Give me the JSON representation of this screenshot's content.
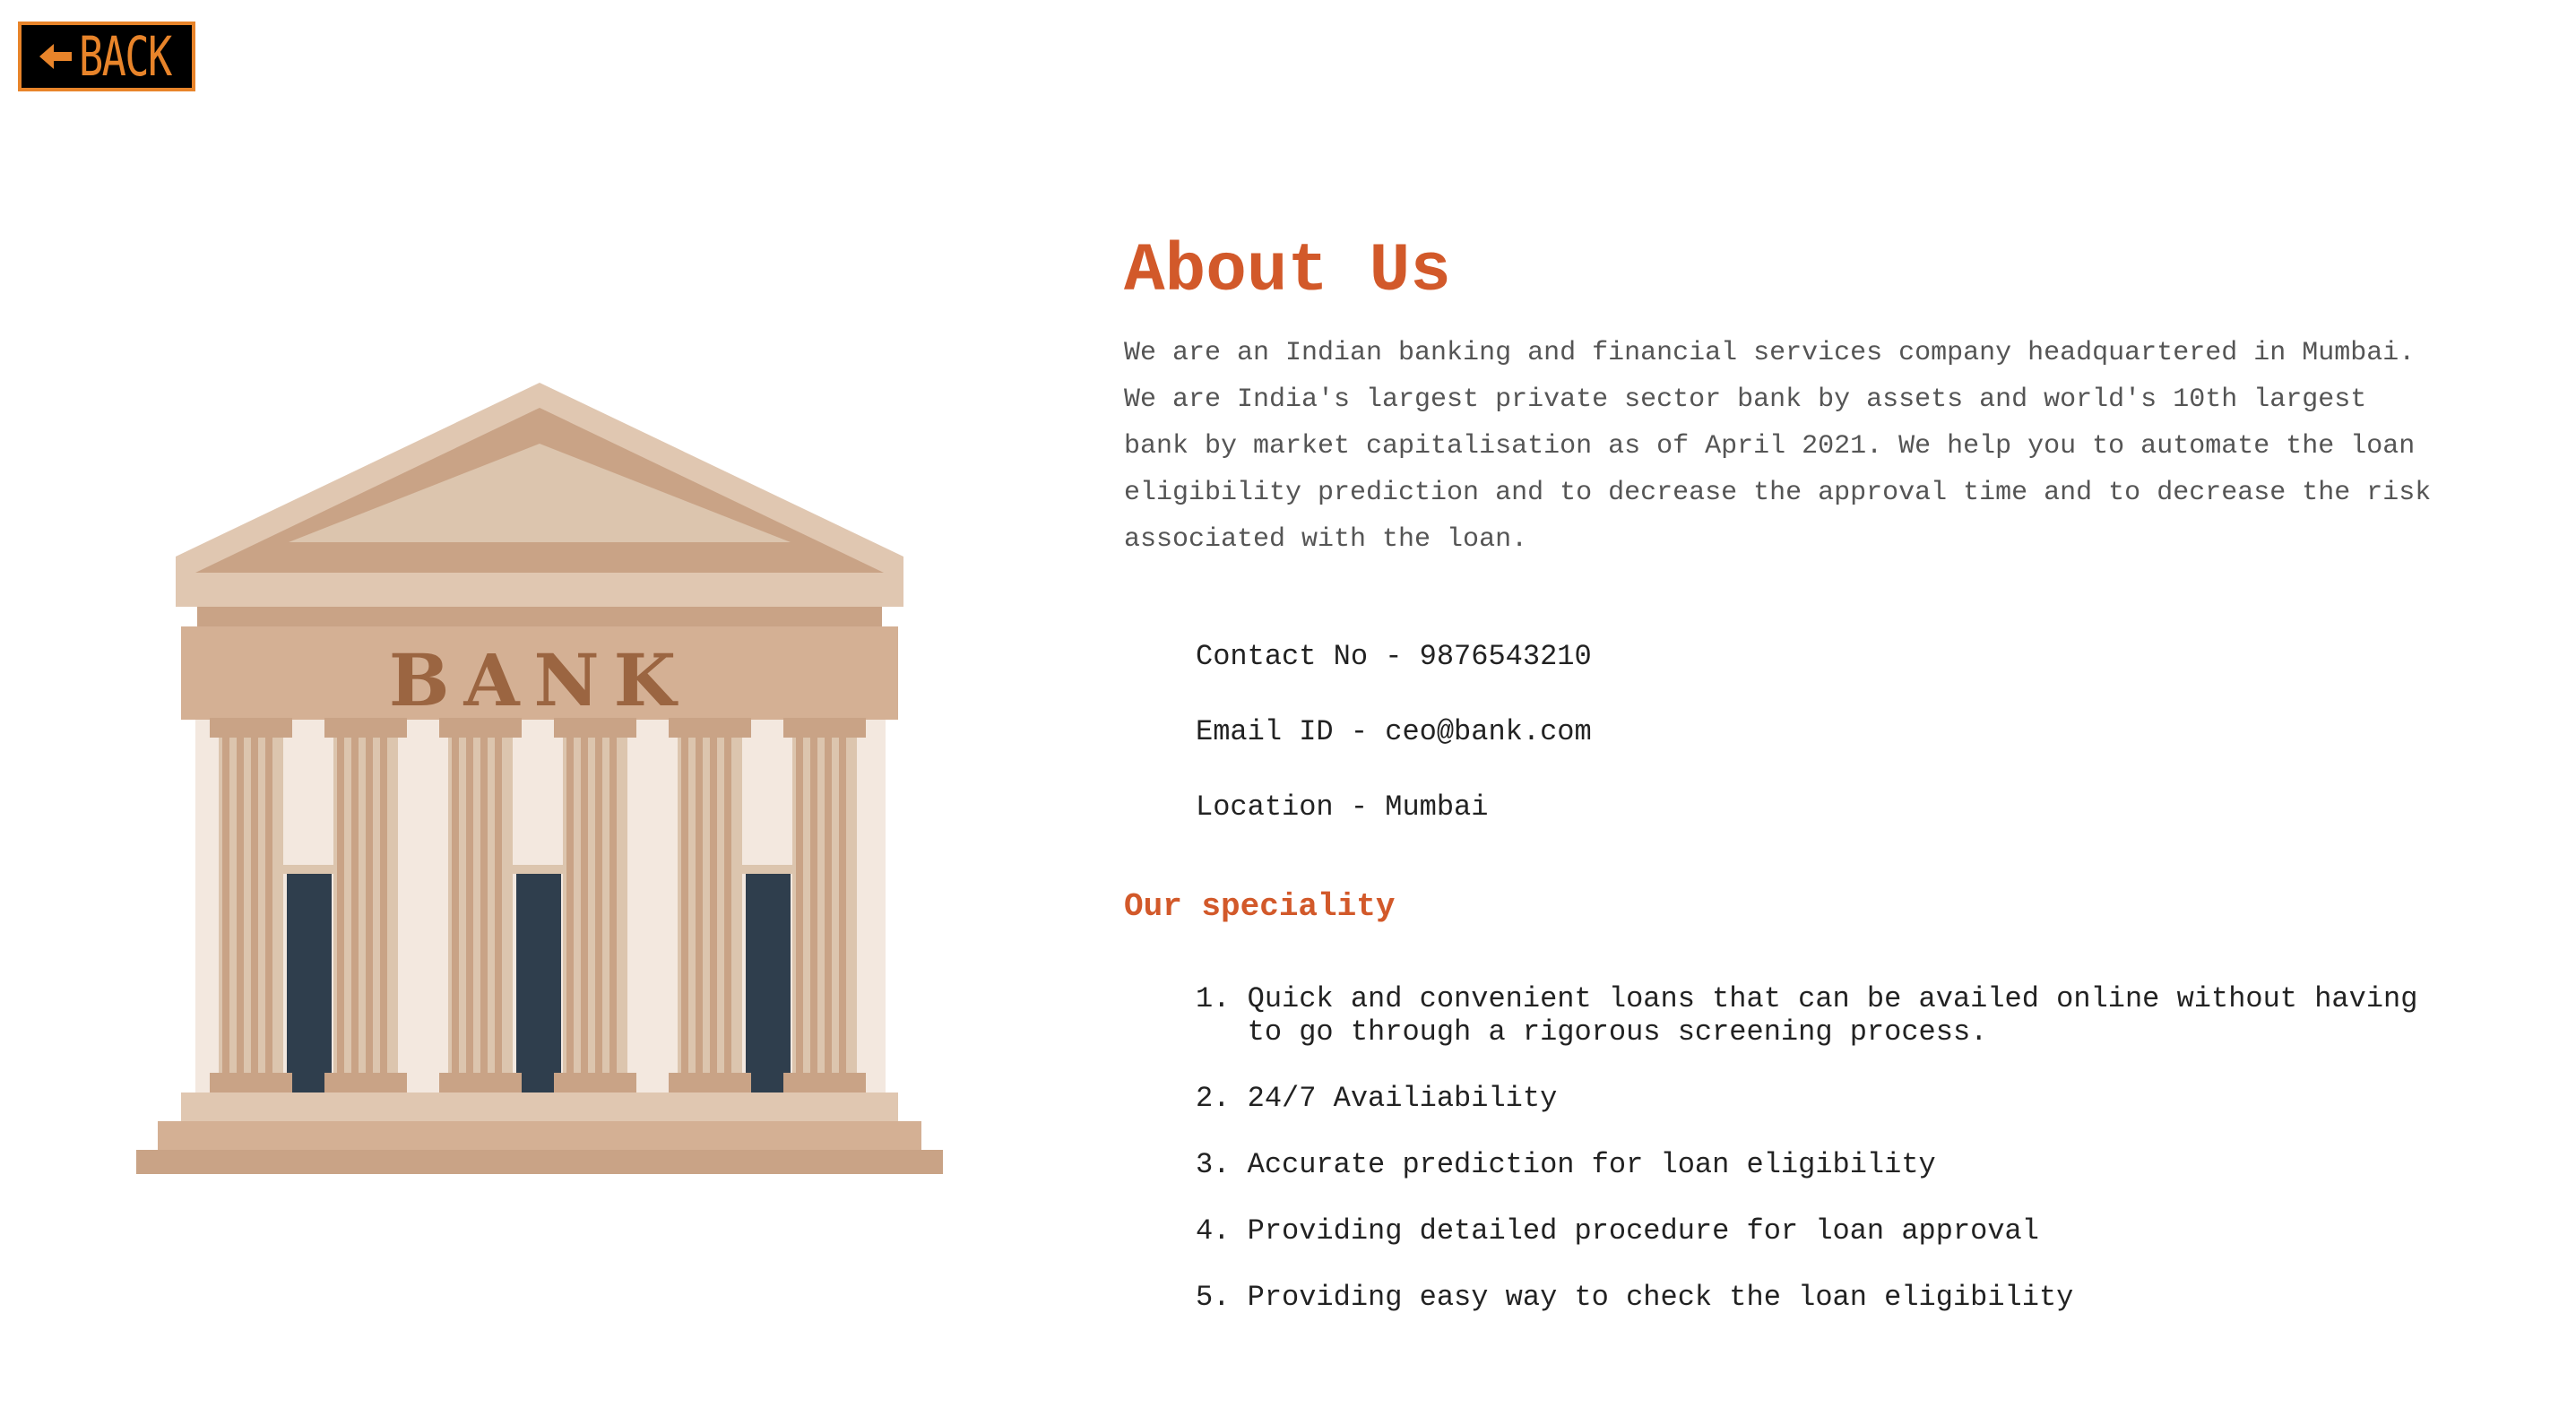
{
  "back_button": {
    "label": "BACK",
    "icon": "left-arrow-icon",
    "accent_color": "#e8842a"
  },
  "illustration": {
    "sign_text": "BANK",
    "icon": "bank-building-icon"
  },
  "about": {
    "title": "About Us",
    "description": "We are an Indian banking and financial services company headquartered in Mumbai. We are India's largest private sector bank by assets and world's 10th largest bank by market capitalisation as of April 2021. We help you to automate the loan eligibility prediction and to decrease the approval time and to decrease the risk associated with the loan.",
    "title_color": "#d2592a"
  },
  "contacts": [
    {
      "text": "Contact No - 9876543210"
    },
    {
      "text": "Email ID - ceo@bank.com"
    },
    {
      "text": "Location - Mumbai"
    }
  ],
  "speciality": {
    "title": "Our speciality",
    "items": [
      {
        "num": "1. ",
        "text": "Quick and convenient loans that can be availed online without having to go through a rigorous screening process."
      },
      {
        "num": "2. ",
        "text": "24/7 Availiability"
      },
      {
        "num": "3. ",
        "text": "Accurate prediction for loan eligibility"
      },
      {
        "num": "4. ",
        "text": "Providing detailed procedure for loan approval"
      },
      {
        "num": "5. ",
        "text": "Providing easy way to check the loan eligibility"
      }
    ]
  }
}
